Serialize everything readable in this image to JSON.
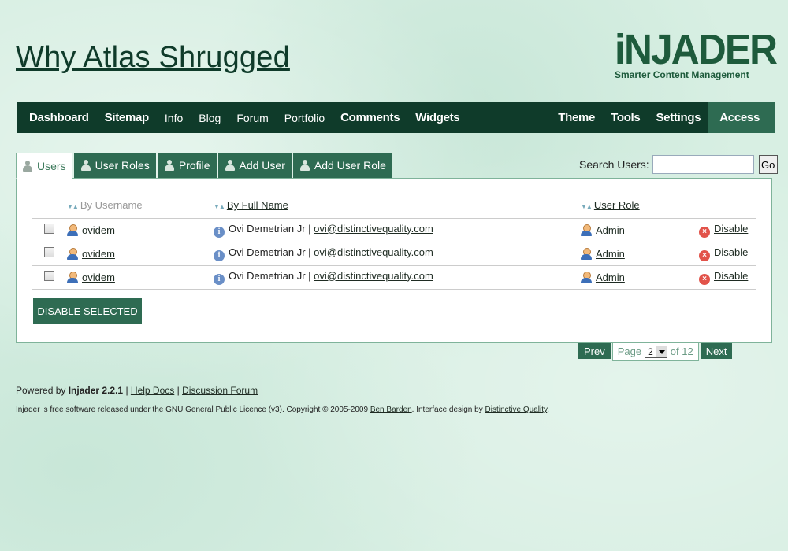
{
  "header": {
    "site_title": "Why Atlas Shrugged",
    "logo_text": "iNJADER",
    "logo_tagline": "Smarter Content Management"
  },
  "nav": {
    "left": [
      {
        "label": "Dashboard",
        "style": "bold"
      },
      {
        "label": "Sitemap",
        "style": "bold"
      },
      {
        "label": "Info",
        "style": "normal"
      },
      {
        "label": "Blog",
        "style": "normal"
      },
      {
        "label": "Forum",
        "style": "normal"
      },
      {
        "label": "Portfolio",
        "style": "normal"
      },
      {
        "label": "Comments",
        "style": "bold"
      },
      {
        "label": "Widgets",
        "style": "bold"
      }
    ],
    "right": [
      {
        "label": "Theme"
      },
      {
        "label": "Tools"
      },
      {
        "label": "Settings"
      },
      {
        "label": "Access",
        "active": true
      }
    ]
  },
  "tabs": [
    {
      "label": "Users",
      "active": true
    },
    {
      "label": "User Roles"
    },
    {
      "label": "Profile"
    },
    {
      "label": "Add User"
    },
    {
      "label": "Add User Role"
    }
  ],
  "search": {
    "label": "Search Users:",
    "value": "",
    "button": "Go"
  },
  "table": {
    "headers": {
      "username": "By Username",
      "fullname": "By Full Name",
      "role": "User Role"
    },
    "rows": [
      {
        "username": "ovidem",
        "fullname": "Ovi Demetrian Jr",
        "separator": "|",
        "email": "ovi@distinctivequality.com",
        "role": "Admin",
        "action": "Disable"
      },
      {
        "username": "ovidem",
        "fullname": "Ovi Demetrian Jr",
        "separator": "|",
        "email": "ovi@distinctivequality.com",
        "role": "Admin",
        "action": "Disable"
      },
      {
        "username": "ovidem",
        "fullname": "Ovi Demetrian Jr",
        "separator": "|",
        "email": "ovi@distinctivequality.com",
        "role": "Admin",
        "action": "Disable"
      }
    ],
    "bulk_button": "DISABLE SELECTED"
  },
  "pager": {
    "prev": "Prev",
    "page_label": "Page",
    "current": "2",
    "of_label": "of 12",
    "next": "Next"
  },
  "footer": {
    "powered_prefix": "Powered by",
    "product": "Injader 2.2.1",
    "sep": "|",
    "help": "Help Docs",
    "forum": "Discussion Forum",
    "license_text": "Injader is free software released under the GNU General Public Licence (v3). Copyright © 2005-2009",
    "author": "Ben Barden",
    "design_text": ". Interface design by",
    "designer": "Distinctive Quality",
    "end": "."
  },
  "colors": {
    "nav_bg": "#0f3b2a",
    "accent": "#2e6b52",
    "background": "#d8efe3"
  }
}
